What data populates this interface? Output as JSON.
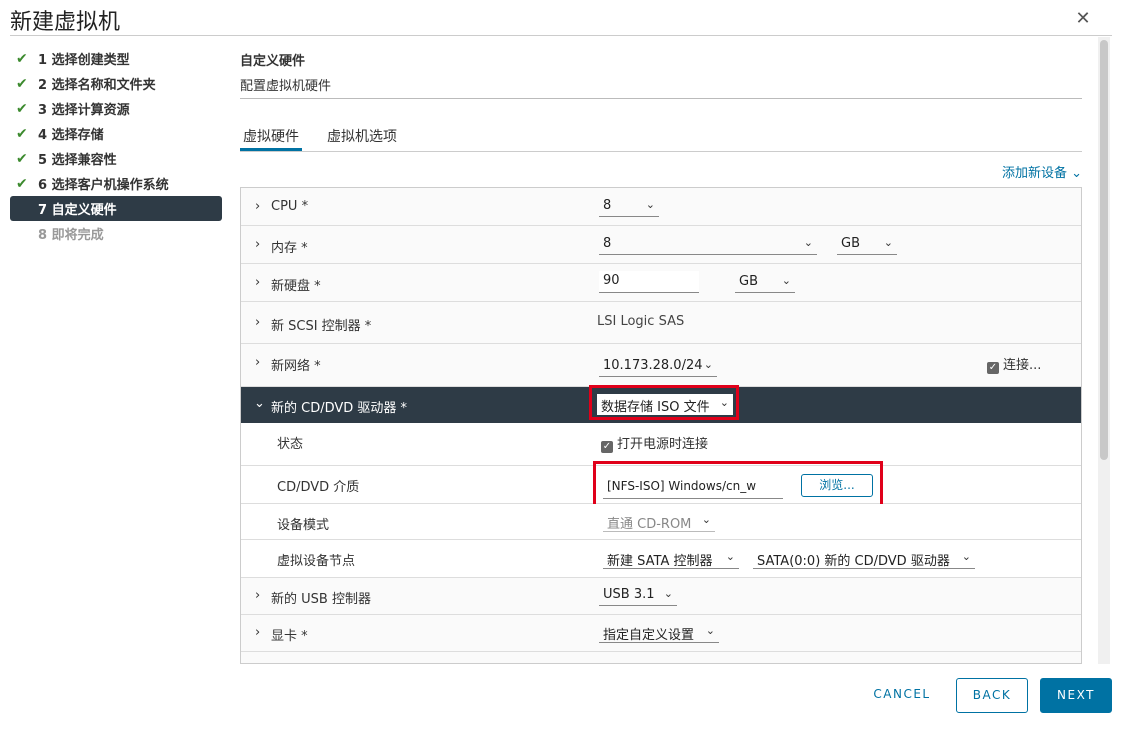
{
  "window": {
    "title": "新建虚拟机"
  },
  "steps": [
    {
      "label": "1 选择创建类型",
      "state": "done"
    },
    {
      "label": "2 选择名称和文件夹",
      "state": "done"
    },
    {
      "label": "3 选择计算资源",
      "state": "done"
    },
    {
      "label": "4 选择存储",
      "state": "done"
    },
    {
      "label": "5 选择兼容性",
      "state": "done"
    },
    {
      "label": "6 选择客户机操作系统",
      "state": "done"
    },
    {
      "label": "7 自定义硬件",
      "state": "active"
    },
    {
      "label": "8 即将完成",
      "state": "future"
    }
  ],
  "section": {
    "title": "自定义硬件",
    "subtitle": "配置虚拟机硬件"
  },
  "tabs": {
    "hardware": "虚拟硬件",
    "options": "虚拟机选项"
  },
  "add_device": "添加新设备",
  "hw": {
    "cpu": {
      "label": "CPU *",
      "value": "8"
    },
    "memory": {
      "label": "内存 *",
      "value": "8",
      "unit": "GB"
    },
    "disk": {
      "label": "新硬盘 *",
      "value": "90",
      "unit": "GB"
    },
    "scsi": {
      "label": "新 SCSI 控制器 *",
      "value": "LSI Logic SAS"
    },
    "network": {
      "label": "新网络 *",
      "value": "10.173.28.0/24",
      "connect": "连接..."
    },
    "cdrom": {
      "label": "新的 CD/DVD 驱动器 *",
      "value": "数据存储 ISO 文件",
      "status_label": "状态",
      "status_value": "打开电源时连接",
      "media_label": "CD/DVD 介质",
      "media_value": "[NFS-ISO] Windows/cn_w",
      "browse": "浏览...",
      "mode_label": "设备模式",
      "mode_value": "直通 CD-ROM",
      "node_label": "虚拟设备节点",
      "node_controller": "新建 SATA 控制器",
      "node_value": "SATA(0:0) 新的 CD/DVD 驱动器"
    },
    "usb": {
      "label": "新的 USB 控制器",
      "value": "USB 3.1"
    },
    "video": {
      "label": "显卡 *",
      "value": "指定自定义设置"
    }
  },
  "footer": {
    "cancel": "CANCEL",
    "back": "BACK",
    "next": "NEXT"
  },
  "colors": {
    "accent": "#0072a3",
    "active_row": "#2e3b46",
    "check": "#3c8a2e",
    "highlight": "#e0001a"
  }
}
